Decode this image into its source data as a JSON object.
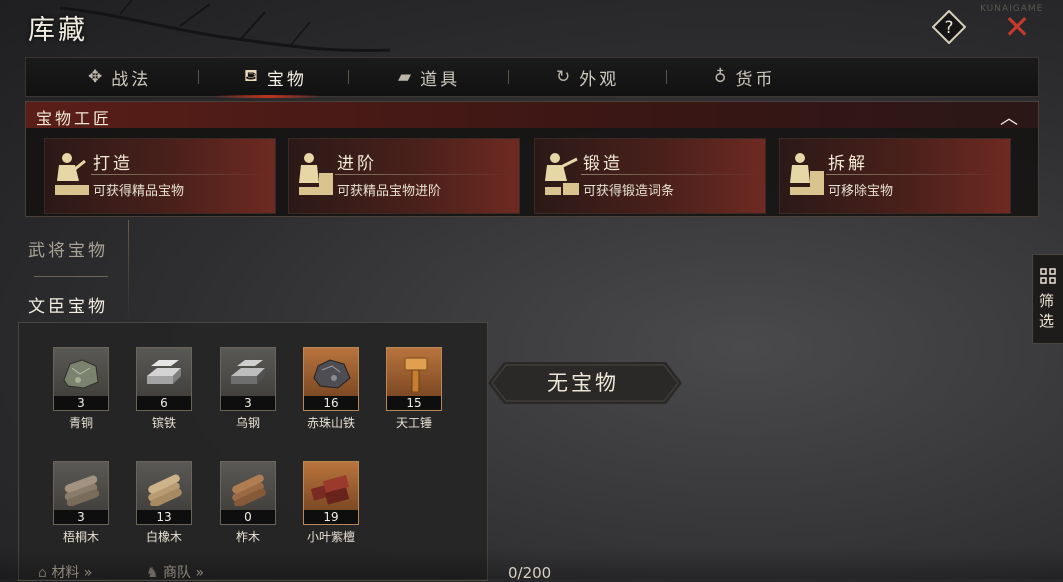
{
  "header": {
    "title": "库藏",
    "help_glyph": "?",
    "close_glyph": "✕"
  },
  "watermark": "KUNAIGAME",
  "tabs": [
    {
      "label": "战法",
      "icon": "scroll-icon",
      "active": false
    },
    {
      "label": "宝物",
      "icon": "treasure-icon",
      "active": true
    },
    {
      "label": "道具",
      "icon": "ingot-icon",
      "active": false
    },
    {
      "label": "外观",
      "icon": "swirl-icon",
      "active": false
    },
    {
      "label": "货币",
      "icon": "coin-bag-icon",
      "active": false
    }
  ],
  "craft": {
    "title": "宝物工匠",
    "cards": [
      {
        "name": "打造",
        "desc": "可获得精品宝物"
      },
      {
        "name": "进阶",
        "desc": "可获精品宝物进阶"
      },
      {
        "name": "锻造",
        "desc": "可获得锻造词条"
      },
      {
        "name": "拆解",
        "desc": "可移除宝物"
      }
    ]
  },
  "categories": {
    "general": "武将宝物",
    "civil": "文臣宝物",
    "active": "civil"
  },
  "materials": [
    {
      "name": "青铜",
      "count": "3",
      "icon": "bronze-ore-icon",
      "rare": false
    },
    {
      "name": "镔铁",
      "count": "6",
      "icon": "iron-ingot-icon",
      "rare": false
    },
    {
      "name": "乌钢",
      "count": "3",
      "icon": "steel-ingot-icon",
      "rare": false
    },
    {
      "name": "赤珠山铁",
      "count": "16",
      "icon": "meteorite-ore-icon",
      "rare": true
    },
    {
      "name": "天工锤",
      "count": "15",
      "icon": "hammer-icon",
      "rare": true
    },
    {
      "name": "梧桐木",
      "count": "3",
      "icon": "wutong-logs-icon",
      "rare": false
    },
    {
      "name": "白橡木",
      "count": "13",
      "icon": "oak-logs-icon",
      "rare": false
    },
    {
      "name": "柞木",
      "count": "0",
      "icon": "zuo-logs-icon",
      "rare": false
    },
    {
      "name": "小叶紫檀",
      "count": "19",
      "icon": "rosewood-logs-icon",
      "rare": true
    }
  ],
  "empty_text": "无宝物",
  "filter_label": "筛选",
  "bottom": {
    "materials_link": "材料 »",
    "shop_link": "商队 »",
    "capacity": "0/200"
  },
  "colors": {
    "accent_red": "#c0351f",
    "close_red": "#c43a2b",
    "rare_tile": "#b9743e"
  }
}
